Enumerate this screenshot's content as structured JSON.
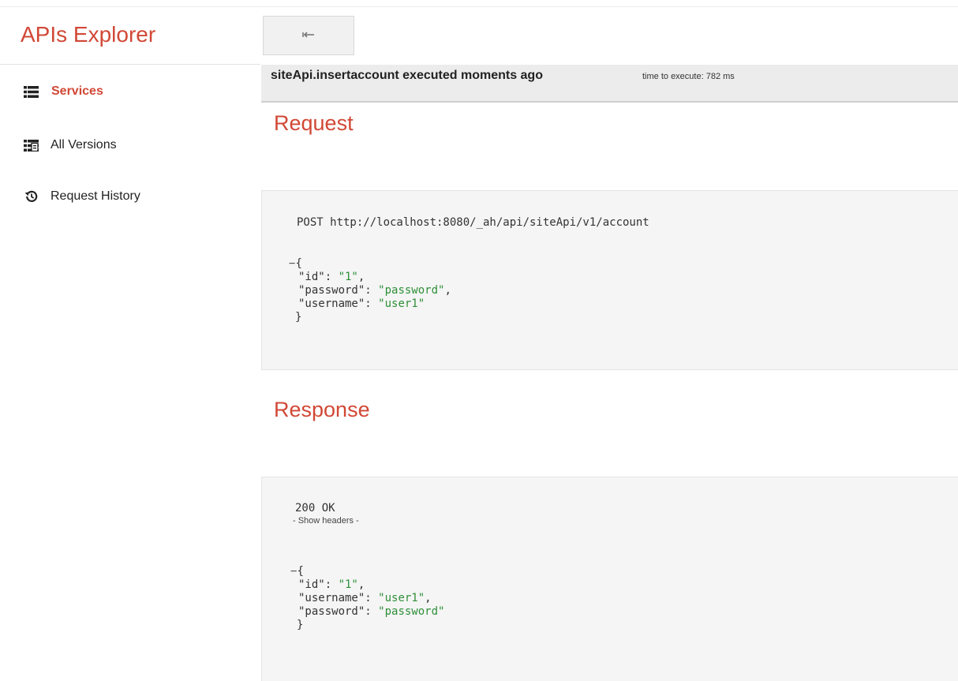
{
  "sidebar": {
    "title": "APIs Explorer",
    "items": [
      {
        "label": "Services",
        "icon": "list-icon",
        "active": true
      },
      {
        "label": "All Versions",
        "icon": "versions-icon",
        "active": false
      },
      {
        "label": "Request History",
        "icon": "history-icon",
        "active": false
      }
    ]
  },
  "toolbar": {
    "back_icon": "back-arrow-icon"
  },
  "execution": {
    "title": "siteApi.insertaccount executed moments ago",
    "time": "time to execute: 782 ms"
  },
  "request": {
    "heading": "Request",
    "line": "POST http://localhost:8080/_ah/api/siteApi/v1/account",
    "open_brace": "{",
    "close_brace": "}",
    "collapse": "−",
    "fields": [
      {
        "key": "\"id\"",
        "sep": ": ",
        "value": "\"1\"",
        "trail": ","
      },
      {
        "key": "\"password\"",
        "sep": ": ",
        "value": "\"password\"",
        "trail": ","
      },
      {
        "key": "\"username\"",
        "sep": ": ",
        "value": "\"user1\"",
        "trail": ""
      }
    ]
  },
  "response": {
    "heading": "Response",
    "status": "200 OK",
    "show_headers": "- Show headers -",
    "open_brace": "{",
    "close_brace": "}",
    "collapse": "−",
    "fields": [
      {
        "key": "\"id\"",
        "sep": ": ",
        "value": "\"1\"",
        "trail": ","
      },
      {
        "key": "\"username\"",
        "sep": ": ",
        "value": "\"user1\"",
        "trail": ","
      },
      {
        "key": "\"password\"",
        "sep": ": ",
        "value": "\"password\"",
        "trail": ""
      }
    ]
  },
  "colors": {
    "accent": "#d14836",
    "string_value": "#2e8f38",
    "panel_bg": "#f5f5f5",
    "bar_bg": "#ececec"
  }
}
